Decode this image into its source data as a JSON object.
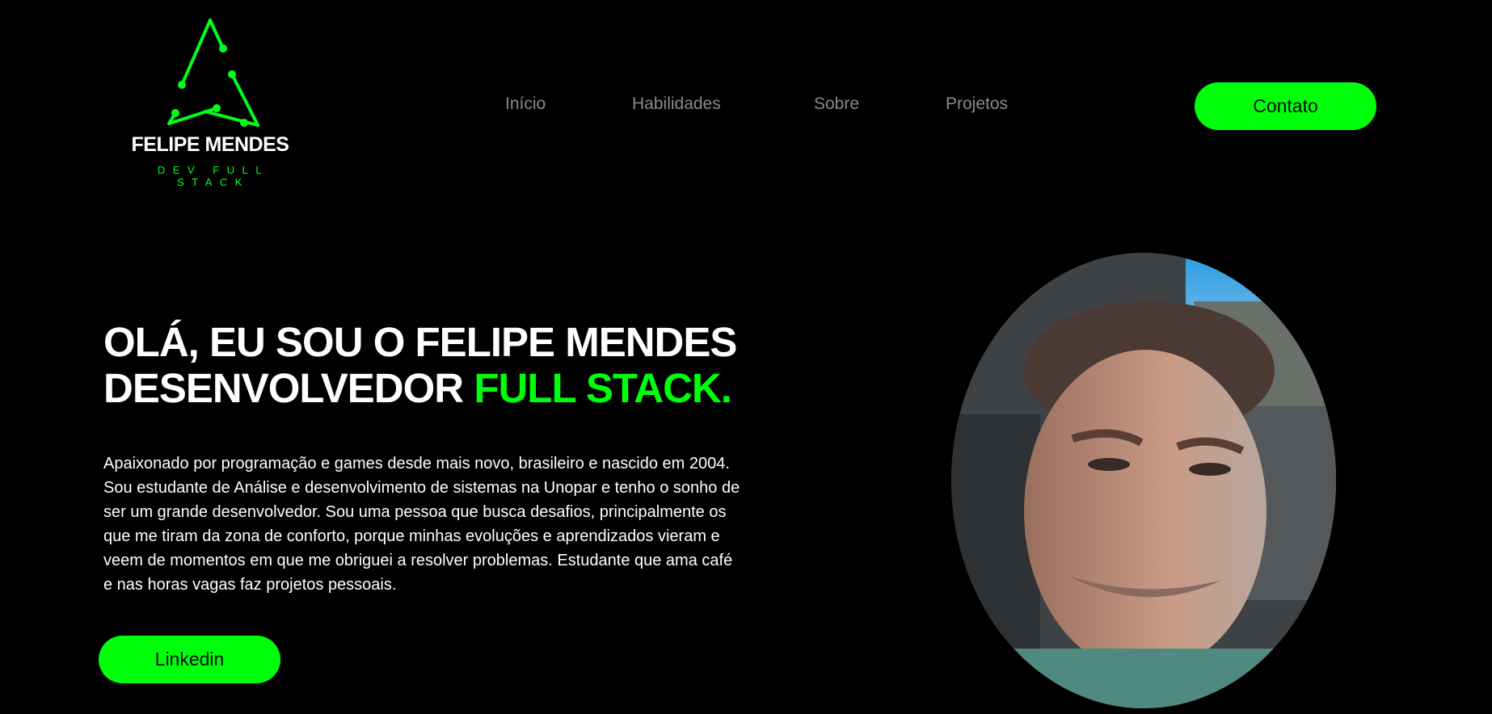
{
  "logo": {
    "name": "FELIPE MENDES",
    "tagline": "DEV FULL STACK",
    "accent_color": "#00ff1a"
  },
  "nav": {
    "items": [
      {
        "label": "Início"
      },
      {
        "label": "Habilidades"
      },
      {
        "label": "Sobre"
      },
      {
        "label": "Projetos"
      }
    ],
    "contact_label": "Contato"
  },
  "hero": {
    "line1": "OLÁ, EU SOU O FELIPE MENDES",
    "line2_prefix": "DESENVOLVEDOR ",
    "line2_accent": "FULL STACK.",
    "bio_lines": [
      "Apaixonado por programação e games desde mais novo, brasileiro e nascido em 2004.",
      "Sou estudante de Análise e desenvolvimento de sistemas na Unopar e tenho o sonho de",
      "ser um grande desenvolvedor. Sou uma pessoa que busca desafios, principalmente os",
      "que me tiram da zona de conforto, porque minhas evoluções e aprendizados vieram e",
      "veem de momentos em que me obriguei a resolver problemas. Estudante que ama café",
      "e nas horas vagas faz projetos pessoais."
    ],
    "linkedin_label": "Linkedin"
  },
  "colors": {
    "background": "#000000",
    "accent": "#00ff0a",
    "nav_text": "#8a8a8a"
  }
}
